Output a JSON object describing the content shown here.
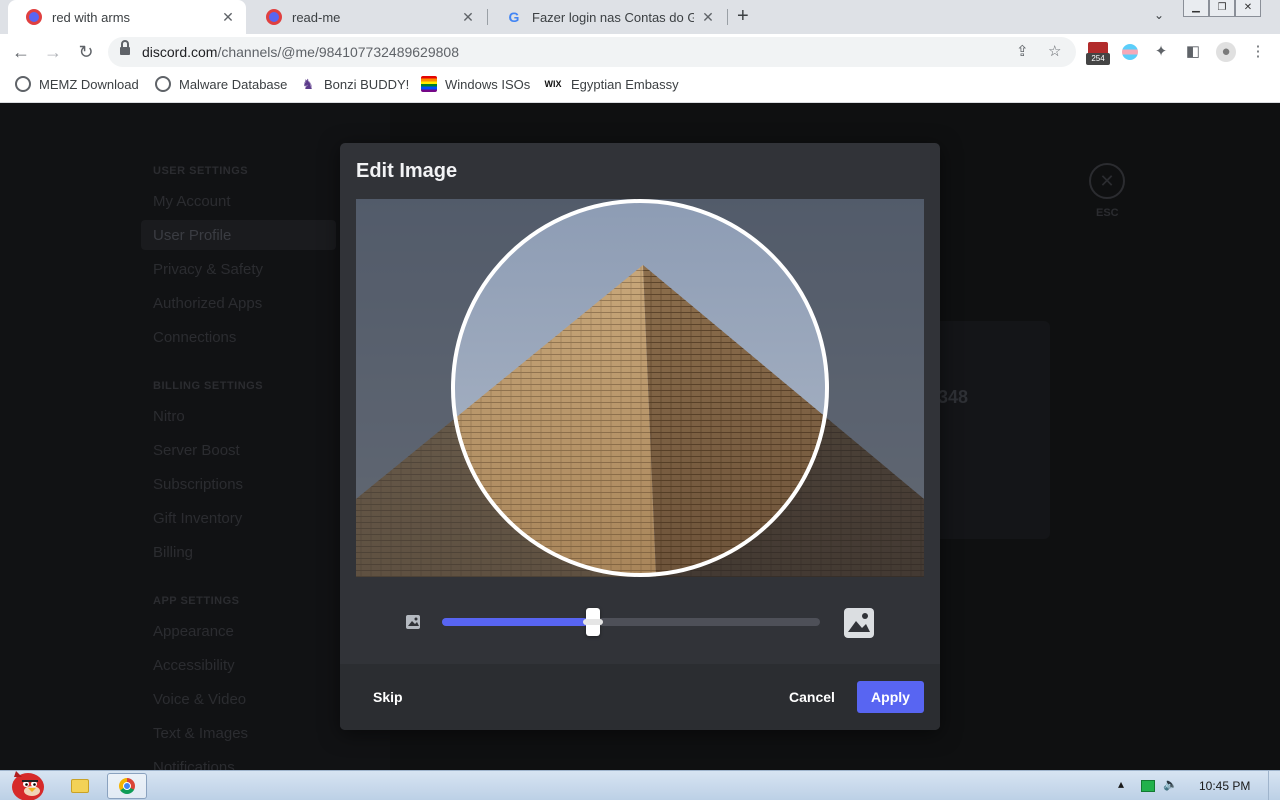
{
  "browser": {
    "tabs": [
      {
        "title": "red with arms",
        "active": true
      },
      {
        "title": "read-me",
        "active": false
      },
      {
        "title": "Fazer login nas Contas do Goo",
        "active": false
      }
    ],
    "url_host": "discord.com",
    "url_path": "/channels/@me/984107732489629808",
    "extension_badge": "254",
    "bookmarks": [
      {
        "label": "MEMZ Download",
        "icon": "globe-icon"
      },
      {
        "label": "Malware Database",
        "icon": "globe-icon"
      },
      {
        "label": "Bonzi BUDDY!",
        "icon": "bonzi-icon"
      },
      {
        "label": "Windows ISOs",
        "icon": "rainbow-flag-icon"
      },
      {
        "label": "Egyptian Embassy",
        "icon": "wix-icon"
      }
    ]
  },
  "settings_nav": {
    "user_header": "USER SETTINGS",
    "user_items": [
      "My Account",
      "User Profile",
      "Privacy & Safety",
      "Authorized Apps",
      "Connections"
    ],
    "billing_header": "BILLING SETTINGS",
    "billing_items": [
      "Nitro",
      "Server Boost",
      "Subscriptions",
      "Gift Inventory",
      "Billing"
    ],
    "app_header": "APP SETTINGS",
    "app_items": [
      "Appearance",
      "Accessibility",
      "Voice & Video",
      "Text & Images",
      "Notifications"
    ],
    "esc_label": "ESC",
    "profile_number_fragment": "348"
  },
  "modal": {
    "title": "Edit Image",
    "zoom_level": 0.4,
    "skip_label": "Skip",
    "cancel_label": "Cancel",
    "apply_label": "Apply",
    "accent_color": "#5865f2"
  },
  "taskbar": {
    "clock": "10:45 PM"
  }
}
